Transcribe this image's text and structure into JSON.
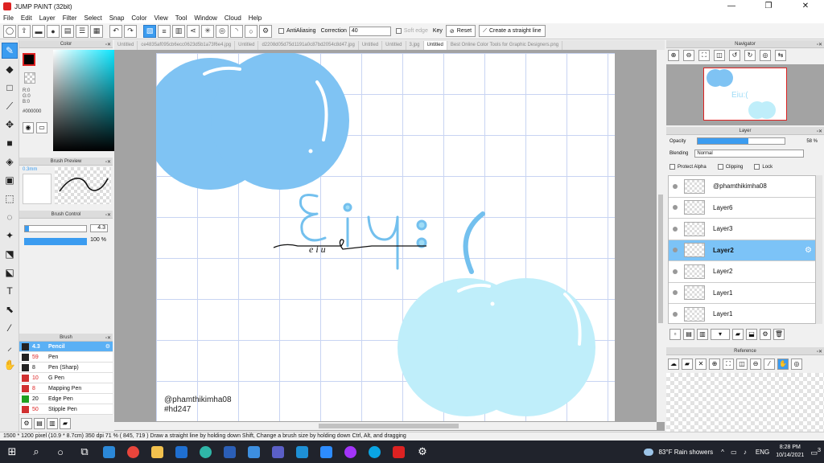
{
  "window": {
    "title": "JUMP PAINT (32bit)",
    "controls": [
      "—",
      "❐",
      "✕"
    ]
  },
  "menu": [
    "File",
    "Edit",
    "Layer",
    "Filter",
    "Select",
    "Snap",
    "Color",
    "View",
    "Tool",
    "Window",
    "Cloud",
    "Help"
  ],
  "toolbar": {
    "antialiasing_label": "AntiAliasing",
    "correction_label": "Correction",
    "correction_value": "40",
    "soft_edge_label": "Soft edge",
    "key_label": "Key",
    "reset_label": "Reset",
    "straight_line_label": "Create a straight line"
  },
  "color_panel": {
    "title": "Color",
    "rgb": [
      "R:0",
      "G:0",
      "B:0"
    ],
    "hex": "#000000",
    "foreground_color": "#000000"
  },
  "brush_preview": {
    "title": "Brush Preview",
    "size": "0.3mm"
  },
  "brush_control": {
    "title": "Brush Control",
    "size_value": "4.3",
    "opacity_value": "100 %",
    "size_fraction": 0.06,
    "opacity_fraction": 1.0
  },
  "brush_panel": {
    "title": "Brush",
    "items": [
      {
        "size": "4.3",
        "name": "Pencil",
        "color": "#222222",
        "active": true
      },
      {
        "size": "59",
        "name": "Pen",
        "color": "#222222",
        "active": false
      },
      {
        "size": "8",
        "name": "Pen (Sharp)",
        "color": "#222222",
        "active": false
      },
      {
        "size": "10",
        "name": "G Pen",
        "color": "#d03030",
        "active": false
      },
      {
        "size": "8",
        "name": "Mapping Pen",
        "color": "#d03030",
        "active": false
      },
      {
        "size": "20",
        "name": "Edge Pen",
        "color": "#20a020",
        "active": false
      },
      {
        "size": "50",
        "name": "Stipple Pen",
        "color": "#d03030",
        "active": false
      }
    ]
  },
  "doc_tabs": [
    {
      "label": "Untitled",
      "active": false
    },
    {
      "label": "ce4835af095cb6ecc0623d5b1a73f6e4.jpg",
      "active": false
    },
    {
      "label": "Untitled",
      "active": false
    },
    {
      "label": "d2208d05d75d1191a0c87bd2054c8d47.jpg",
      "active": false
    },
    {
      "label": "Untitled",
      "active": false
    },
    {
      "label": "Untitled",
      "active": false
    },
    {
      "label": "3.jpg",
      "active": false
    },
    {
      "label": "Untitled",
      "active": true
    },
    {
      "label": "Best Online Color Tools for Graphic Designers.png",
      "active": false
    }
  ],
  "canvas": {
    "handwritten_word": "e   i   u",
    "watermark": [
      "@phamthikimha08",
      "#hd247"
    ],
    "bubble_color_top": "#7fc3f3",
    "bubble_color_bottom": "#bfeefa"
  },
  "navigator": {
    "title": "Navigator"
  },
  "layer_panel": {
    "title": "Layer",
    "opacity_label": "Opacity",
    "opacity_value": "58 %",
    "opacity_fraction": 0.58,
    "blending_label": "Blending",
    "blending_value": "Normal",
    "protect_alpha_label": "Protect Alpha",
    "clipping_label": "Clipping",
    "lock_label": "Lock",
    "layers": [
      {
        "name": "@phamthikimha08",
        "active": false
      },
      {
        "name": "Layer6",
        "active": false
      },
      {
        "name": "Layer3",
        "active": false
      },
      {
        "name": "Layer2",
        "active": true
      },
      {
        "name": "Layer2",
        "active": false
      },
      {
        "name": "Layer1",
        "active": false
      },
      {
        "name": "Layer1",
        "active": false
      }
    ]
  },
  "reference": {
    "title": "Reference"
  },
  "status": {
    "text": "1500 * 1200 pixel  (10.9 * 8.7cm)  350 dpi  71 %  ( 845, 719 )  Draw a straight line by holding down Shift, Change a brush size by holding down Ctrl, Alt, and dragging"
  },
  "taskbar": {
    "weather": "83°F  Rain showers",
    "language": "ENG",
    "time": "8:28 PM",
    "date": "10/14/2021",
    "notification_count": "3"
  }
}
